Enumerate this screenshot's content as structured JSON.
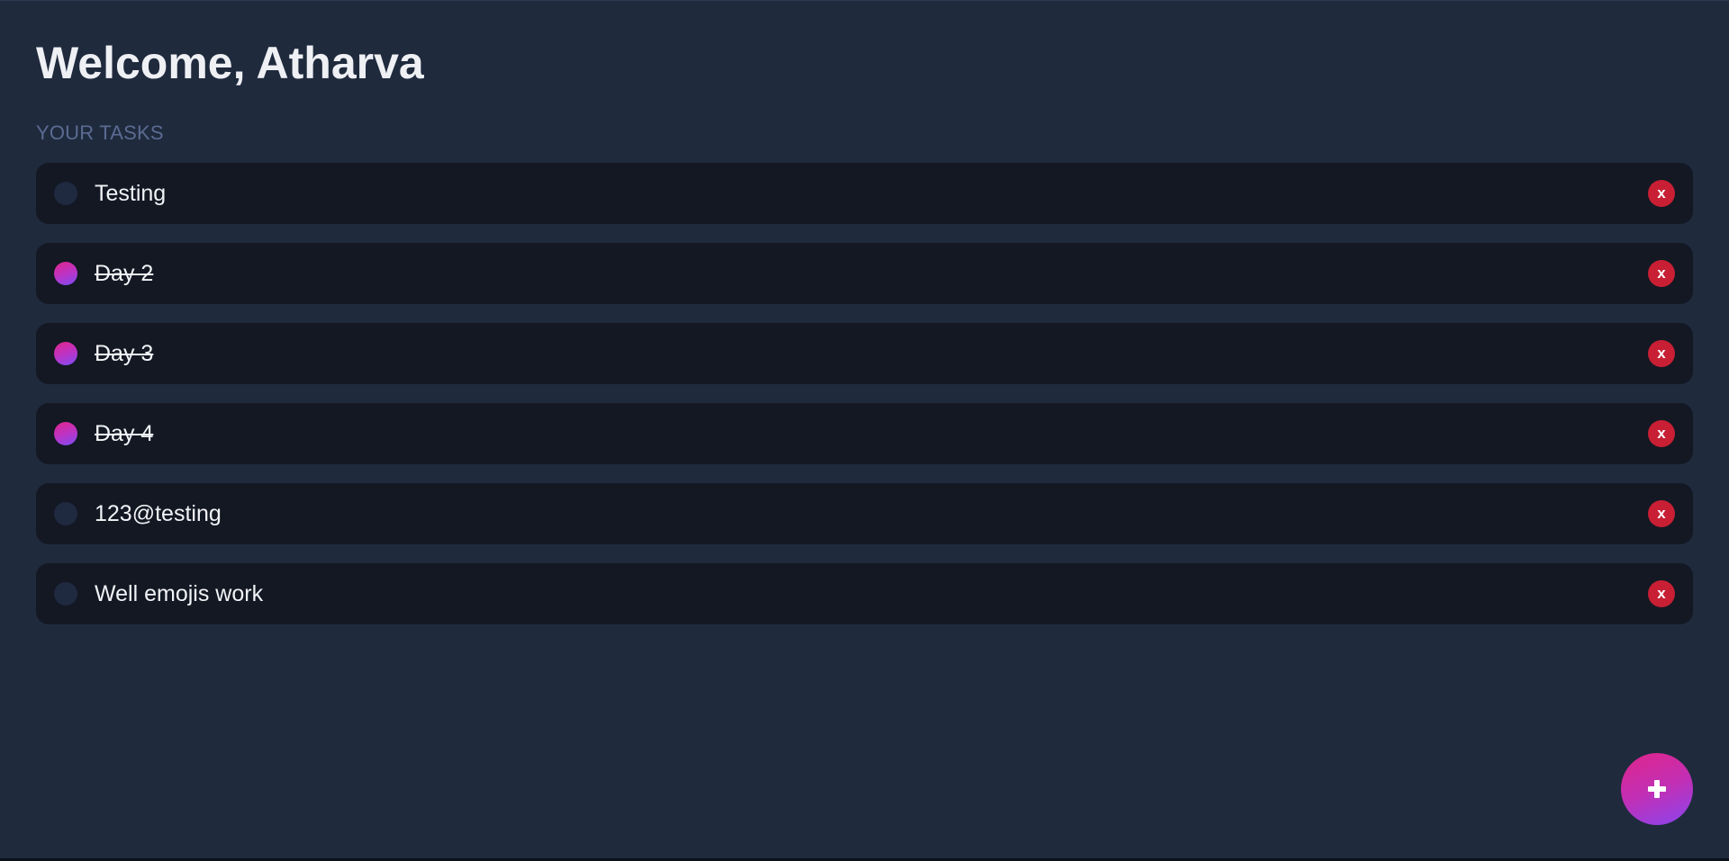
{
  "header": {
    "title": "Welcome, Atharva"
  },
  "tasks_section": {
    "label": "YOUR TASKS"
  },
  "tasks": [
    {
      "text": "Testing",
      "completed": false,
      "delete_label": "x"
    },
    {
      "text": "Day 2",
      "completed": true,
      "delete_label": "x"
    },
    {
      "text": "Day 3",
      "completed": true,
      "delete_label": "x"
    },
    {
      "text": "Day 4",
      "completed": true,
      "delete_label": "x"
    },
    {
      "text": "123@testing",
      "completed": false,
      "delete_label": "x"
    },
    {
      "text": "Well emojis work",
      "completed": false,
      "delete_label": "x"
    }
  ],
  "fab": {
    "icon": "plus-icon"
  },
  "colors": {
    "background": "#1f2a3d",
    "card": "#131823",
    "delete": "#c81f34",
    "accent_start": "#e0258a",
    "accent_end": "#7b4df5",
    "section_label": "#5b6b92"
  }
}
